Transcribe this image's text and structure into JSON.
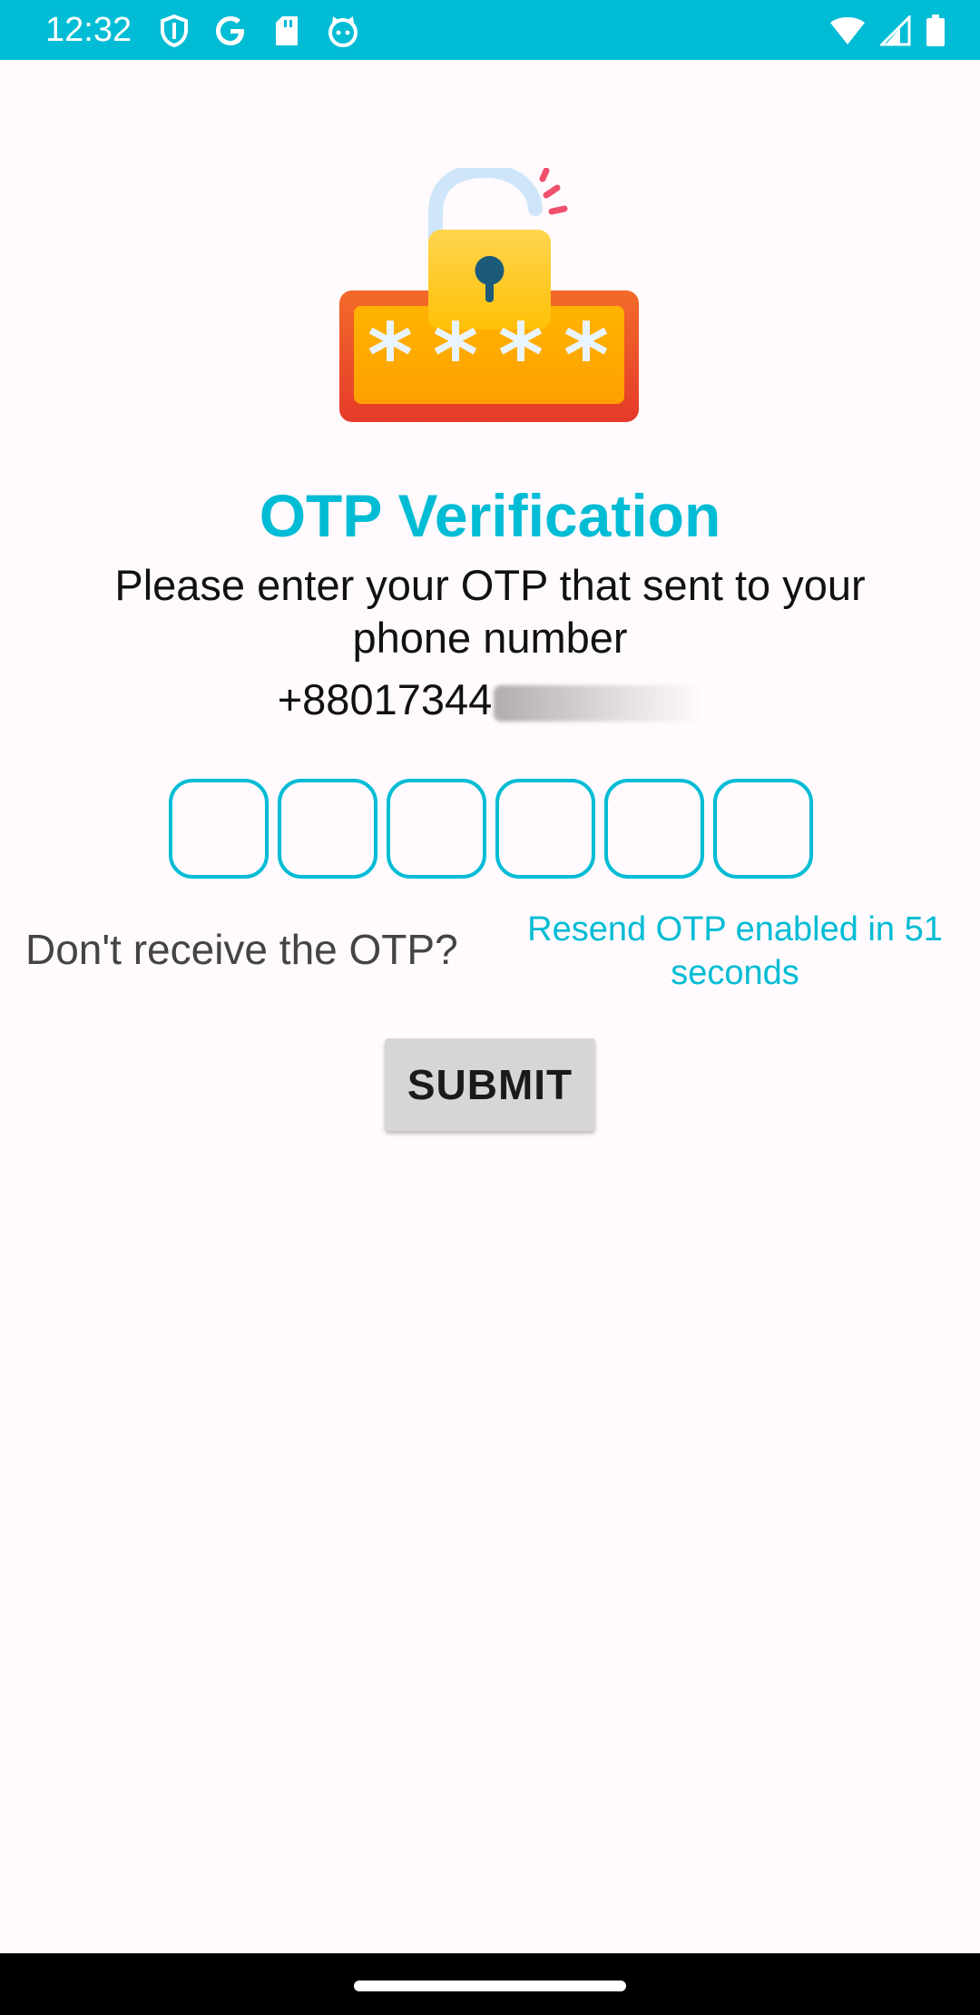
{
  "status_bar": {
    "time": "12:32",
    "left_icons": [
      "shield-icon",
      "google-icon",
      "sd-card-icon",
      "cat-icon"
    ],
    "right_icons": [
      "wifi-icon",
      "signal-icon",
      "battery-icon"
    ]
  },
  "hero": {
    "icon": "padlock-password-icon",
    "password_mask": "****"
  },
  "title": "OTP Verification",
  "subtitle": "Please enter your OTP that sent to your phone number",
  "phone": {
    "visible_prefix": "+88017344"
  },
  "otp": {
    "boxes": [
      "",
      "",
      "",
      "",
      "",
      ""
    ]
  },
  "resend": {
    "question": "Don't receive the OTP?",
    "countdown_text": "Resend OTP enabled in 51 seconds"
  },
  "submit": {
    "label": "SUBMIT"
  },
  "colors": {
    "accent": "#00bcd4",
    "background": "#fffafd",
    "button_bg": "#d6d6d6"
  }
}
